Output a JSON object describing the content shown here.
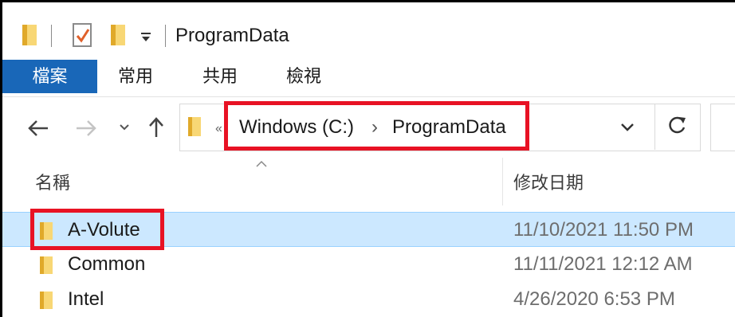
{
  "window": {
    "title": "ProgramData"
  },
  "ribbon": {
    "tabs": [
      {
        "label": "檔案",
        "active": true
      },
      {
        "label": "常用",
        "active": false
      },
      {
        "label": "共用",
        "active": false
      },
      {
        "label": "檢視",
        "active": false
      }
    ]
  },
  "address": {
    "overflow": "«",
    "crumbs": [
      "Windows (C:)",
      "ProgramData"
    ],
    "separator": "›"
  },
  "columns": {
    "name": "名稱",
    "modified": "修改日期"
  },
  "files": [
    {
      "name": "A-Volute",
      "modified": "11/10/2021 11:50 PM",
      "selected": true
    },
    {
      "name": "Common",
      "modified": "11/11/2021 12:12 AM",
      "selected": false
    },
    {
      "name": "Intel",
      "modified": "4/26/2020 6:53 PM",
      "selected": false
    }
  ],
  "colors": {
    "accent": "#1967b8",
    "highlight": "#e81224",
    "selection": "#cce8ff",
    "folder": "#f8d775"
  },
  "icons": [
    "folder-icon",
    "properties-check-icon",
    "customize-dropdown-icon",
    "back-arrow-icon",
    "forward-arrow-icon",
    "recent-chevron-icon",
    "up-arrow-icon",
    "refresh-icon",
    "sort-ascending-icon"
  ]
}
